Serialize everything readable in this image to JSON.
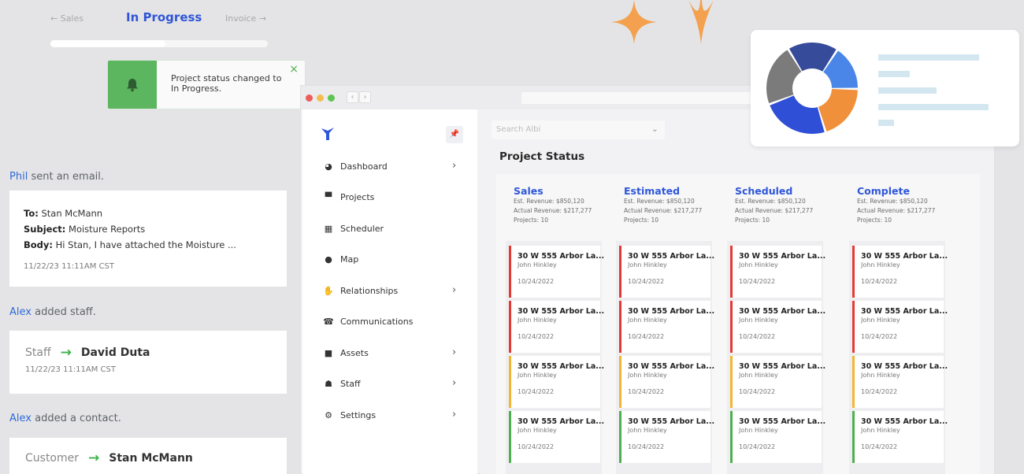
{
  "steps": {
    "prev_label": "← Sales",
    "current_label": "In Progress",
    "next_label": "Invoice →",
    "progress_fraction": 0.53
  },
  "toast": {
    "message": "Project status changed to In Progress.",
    "close_symbol": "×",
    "icon": "bell-icon"
  },
  "activity": {
    "email": {
      "actor": "Phil",
      "action": "sent an email.",
      "to_label": "To:",
      "to_value": "Stan McMann",
      "subject_label": "Subject:",
      "subject_value": "Moisture Reports",
      "body_label": "Body:",
      "body_value": "Hi Stan, I have attached the Moisture ...",
      "timestamp": "11/22/23 11:11AM CST"
    },
    "staff": {
      "actor": "Alex",
      "action": "added staff.",
      "from": "Staff",
      "to": "David Duta",
      "timestamp": "11/22/23 11:11AM CST"
    },
    "contact": {
      "actor": "Alex",
      "action": "added a contact.",
      "from": "Customer",
      "to": "Stan McMann"
    }
  },
  "app": {
    "sidebar": {
      "pin_symbol": "📌",
      "items": [
        {
          "label": "Dashboard",
          "icon": "palette-icon",
          "chevron": true
        },
        {
          "label": "Projects",
          "icon": "briefcase-icon",
          "chevron": false
        },
        {
          "label": "Scheduler",
          "icon": "calendar-icon",
          "chevron": false
        },
        {
          "label": "Map",
          "icon": "map-pin-icon",
          "chevron": false
        },
        {
          "label": "Relationships",
          "icon": "handshake-icon",
          "chevron": true
        },
        {
          "label": "Communications",
          "icon": "phone-icon",
          "chevron": false
        },
        {
          "label": "Assets",
          "icon": "truck-icon",
          "chevron": true
        },
        {
          "label": "Staff",
          "icon": "users-icon",
          "chevron": true
        },
        {
          "label": "Settings",
          "icon": "gear-icon",
          "chevron": true
        }
      ]
    },
    "search": {
      "placeholder": "Search Albi"
    },
    "page_title": "Project Status",
    "columns": [
      {
        "title": "Sales",
        "est_revenue": "Est. Revenue: $850,120",
        "actual_revenue": "Actual Revenue: $217,277",
        "projects": "Projects: 10"
      },
      {
        "title": "Estimated",
        "est_revenue": "Est. Revenue: $850,120",
        "actual_revenue": "Actual Revenue: $217,277",
        "projects": "Projects: 10"
      },
      {
        "title": "Scheduled",
        "est_revenue": "Est. Revenue: $850,120",
        "actual_revenue": "Actual Revenue: $217,277",
        "projects": "Projects: 10"
      },
      {
        "title": "Complete",
        "est_revenue": "Est. Revenue: $850,120",
        "actual_revenue": "Actual Revenue: $217,277",
        "projects": "Projects: 10"
      }
    ],
    "cards": [
      {
        "address": "30 W 555 Arbor La...",
        "owner": "John Hinkley",
        "date": "10/24/2022",
        "status_color": "#e53935"
      },
      {
        "address": "30 W 555 Arbor La...",
        "owner": "John Hinkley",
        "date": "10/24/2022",
        "status_color": "#e53935"
      },
      {
        "address": "30 W 555 Arbor La...",
        "owner": "John Hinkley",
        "date": "10/24/2022",
        "status_color": "#f2b632"
      },
      {
        "address": "30 W 555 Arbor La...",
        "owner": "John Hinkley",
        "date": "10/24/2022",
        "status_color": "#4caf50"
      }
    ]
  },
  "donut_widget": {
    "segments": [
      {
        "name": "navy",
        "color": "#364b9a",
        "fraction": 0.18
      },
      {
        "name": "blue",
        "color": "#4a86e8",
        "fraction": 0.16
      },
      {
        "name": "orange",
        "color": "#f0903a",
        "fraction": 0.2
      },
      {
        "name": "royal",
        "color": "#2f4fd6",
        "fraction": 0.24
      },
      {
        "name": "grey",
        "color": "#7b7b7b",
        "fraction": 0.22
      }
    ]
  },
  "colors": {
    "accent_blue": "#2f56d9",
    "success_green": "#5cb55f",
    "sparkle_orange": "#f3a14e"
  }
}
